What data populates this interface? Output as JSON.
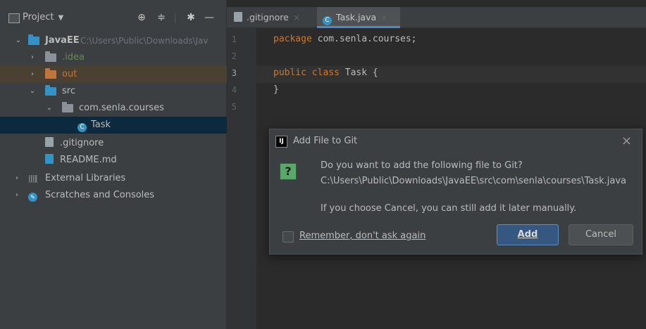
{
  "project": {
    "header_label": "Project",
    "tree": [
      {
        "label": "JavaEE",
        "path": "C:\\Users\\Public\\Downloads\\Jav"
      },
      {
        "label": ".idea"
      },
      {
        "label": "out"
      },
      {
        "label": "src"
      },
      {
        "label": "com.senla.courses"
      },
      {
        "label": "Task"
      },
      {
        "label": ".gitignore"
      },
      {
        "label": "README.md"
      },
      {
        "label": "External Libraries"
      },
      {
        "label": "Scratches and Consoles"
      }
    ]
  },
  "tabs": [
    {
      "label": ".gitignore"
    },
    {
      "label": "Task.java"
    }
  ],
  "editor": {
    "line_numbers": [
      "1",
      "2",
      "3",
      "4",
      "5"
    ],
    "line1_kw": "package",
    "line1_rest": " com.senla.courses;",
    "line3_kw": "public class",
    "line3_rest": " Task {",
    "line4": "}"
  },
  "dialog": {
    "title": "Add File to Git",
    "question": "Do you want to add the following file to Git?",
    "path": "C:\\Users\\Public\\Downloads\\JavaEE\\src\\com\\senla\\courses\\Task.java",
    "note": "If you choose Cancel, you can still add it later manually.",
    "checkbox_label": "Remember, don't ask again",
    "add_label": "Add",
    "cancel_label": "Cancel"
  },
  "colors": {
    "selection": "#0d293e",
    "keyword": "#cc7832",
    "folder_blue": "#3592c4",
    "folder_orange": "#c0763a",
    "accent": "#4a88c7"
  }
}
